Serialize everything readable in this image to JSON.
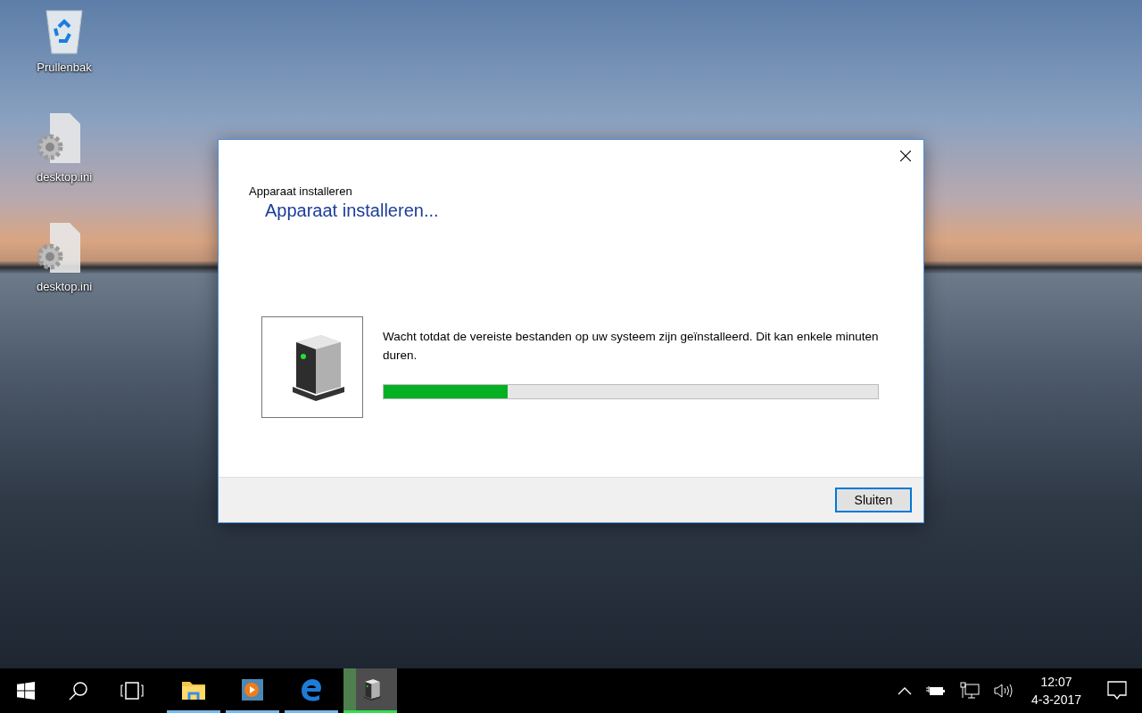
{
  "desktop_icons": [
    {
      "kind": "recycle-bin",
      "label": "Prullenbak"
    },
    {
      "kind": "settings-file",
      "label": "desktop.ini"
    },
    {
      "kind": "settings-file",
      "label": "desktop.ini"
    }
  ],
  "dialog": {
    "title": "Apparaat installeren",
    "heading": "Apparaat installeren...",
    "message": "Wacht totdat de vereiste bestanden op uw systeem zijn geïnstalleerd. Dit kan enkele minuten duren.",
    "progress": {
      "level": 0.25
    },
    "buttons": [
      "Sluiten"
    ]
  },
  "taskbar": {
    "apps": [
      {
        "kind": "explorer",
        "running": true,
        "selected": false
      },
      {
        "kind": "media",
        "running": true,
        "selected": false
      },
      {
        "kind": "edge",
        "running": true,
        "selected": false
      },
      {
        "kind": "device",
        "running": true,
        "selected": true
      }
    ],
    "clock": {
      "time": "12:07",
      "date": "4-3-2017"
    }
  }
}
